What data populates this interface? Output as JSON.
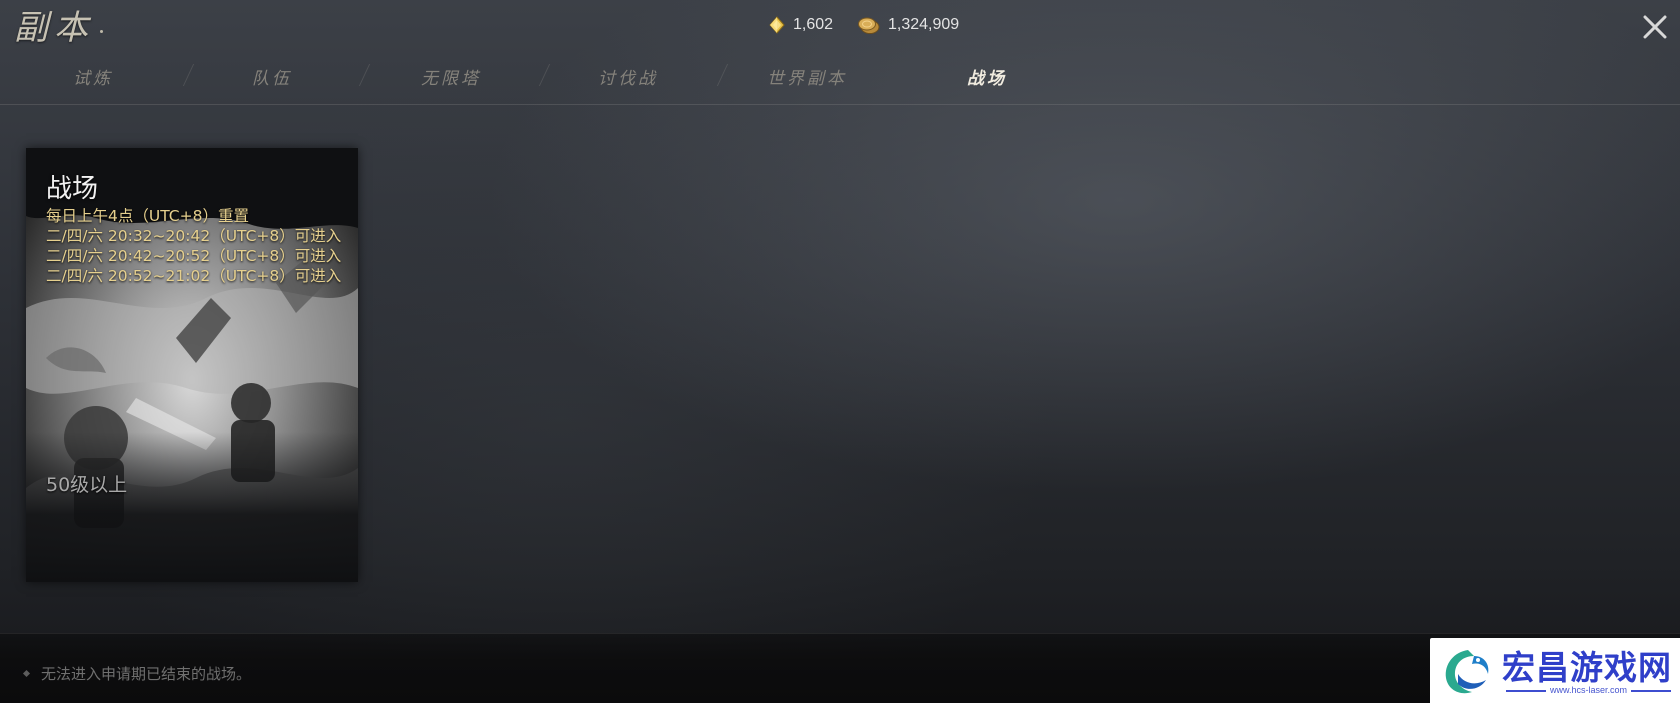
{
  "header": {
    "title": "副本",
    "currencies": [
      {
        "name": "gem",
        "amount": "1,602",
        "icon": "gem-icon",
        "color": "#e8c34a"
      },
      {
        "name": "coin",
        "amount": "1,324,909",
        "icon": "coin-icon",
        "color": "#d1a64c"
      }
    ],
    "close_icon": "close-icon"
  },
  "tabs": [
    {
      "label": "试炼",
      "active": false
    },
    {
      "label": "队伍",
      "active": false
    },
    {
      "label": "无限塔",
      "active": false
    },
    {
      "label": "讨伐战",
      "active": false
    },
    {
      "label": "世界副本",
      "active": false
    },
    {
      "label": "战场",
      "active": true
    }
  ],
  "card": {
    "title": "战场",
    "lines": [
      "每日上午4点（UTC+8）重置",
      "二/四/六 20:32~20:42（UTC+8）可进入",
      "二/四/六 20:42~20:52（UTC+8）可进入",
      "二/四/六 20:52~21:02（UTC+8）可进入"
    ],
    "level_requirement": "50级以上",
    "text_color": "#e6d08e"
  },
  "footer": {
    "notice": "无法进入申请期已结束的战场。"
  },
  "watermark": {
    "text": "宏昌游戏网",
    "url": "www.hcs-laser.com",
    "color": "#2f3fc9"
  }
}
